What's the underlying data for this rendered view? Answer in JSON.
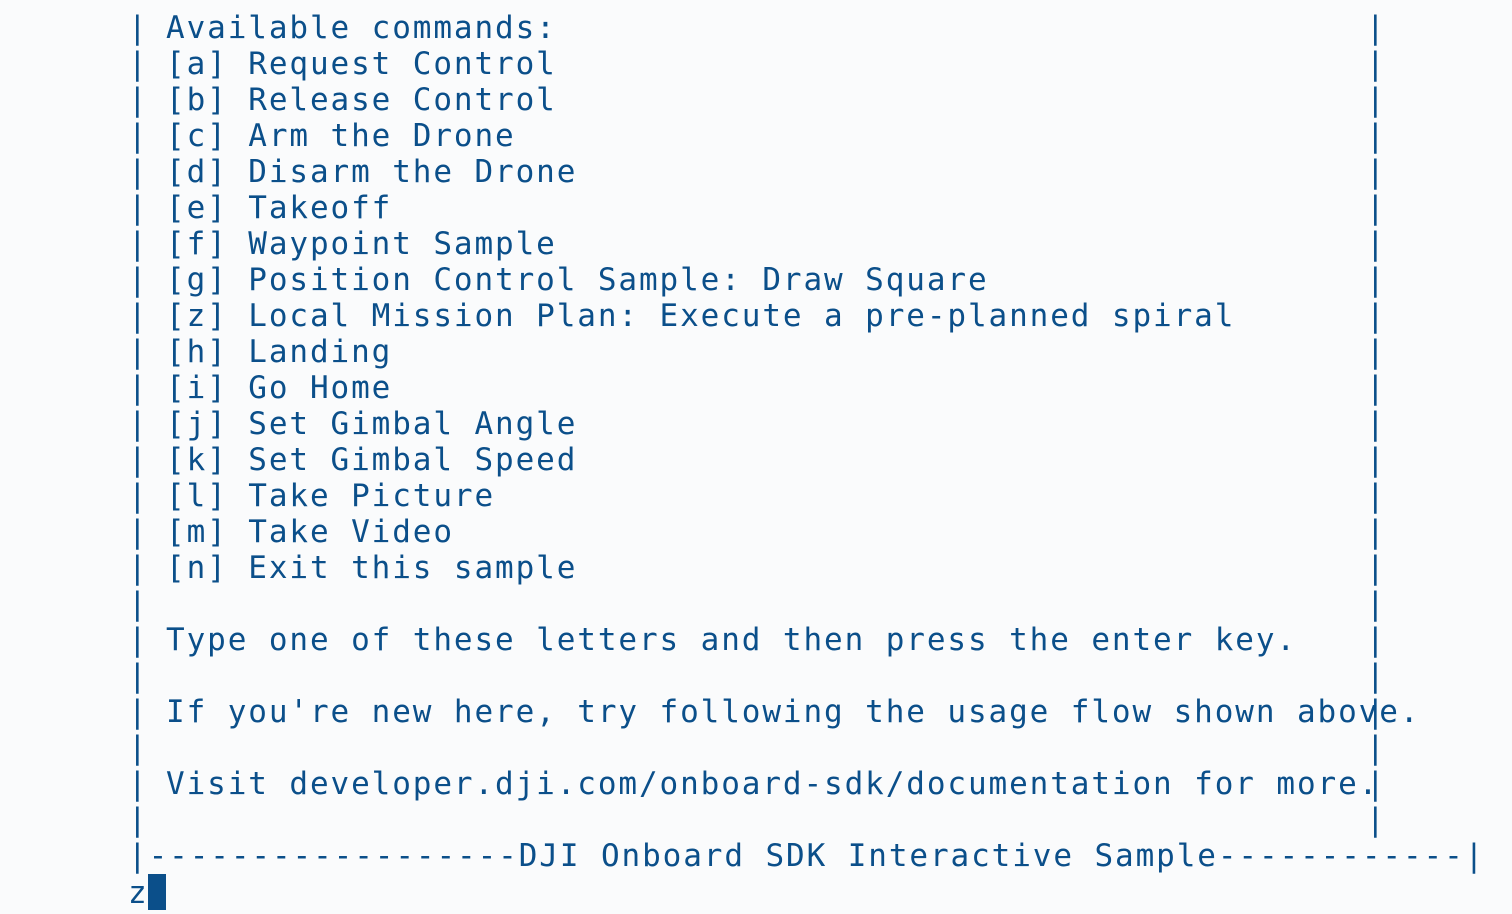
{
  "terminal": {
    "lines": [
      "Available commands:",
      "[a] Request Control",
      "[b] Release Control",
      "[c] Arm the Drone",
      "[d] Disarm the Drone",
      "[e] Takeoff",
      "[f] Waypoint Sample",
      "[g] Position Control Sample: Draw Square",
      "[z] Local Mission Plan: Execute a pre-planned spiral",
      "[h] Landing",
      "[i] Go Home",
      "[j] Set Gimbal Angle",
      "[k] Set Gimbal Speed",
      "[l] Take Picture",
      "[m] Take Video",
      "[n] Exit this sample",
      "",
      "Type one of these letters and then press the enter key.",
      "",
      "If you're new here, try following the usage flow shown above.",
      "",
      "Visit developer.dji.com/onboard-sdk/documentation for more.",
      ""
    ],
    "border_char": "|",
    "footer": "|------------------DJI Onboard SDK Interactive Sample------------|",
    "input_value": "z"
  },
  "colors": {
    "text": "#0b4f8a",
    "background": "#fafbfc"
  }
}
